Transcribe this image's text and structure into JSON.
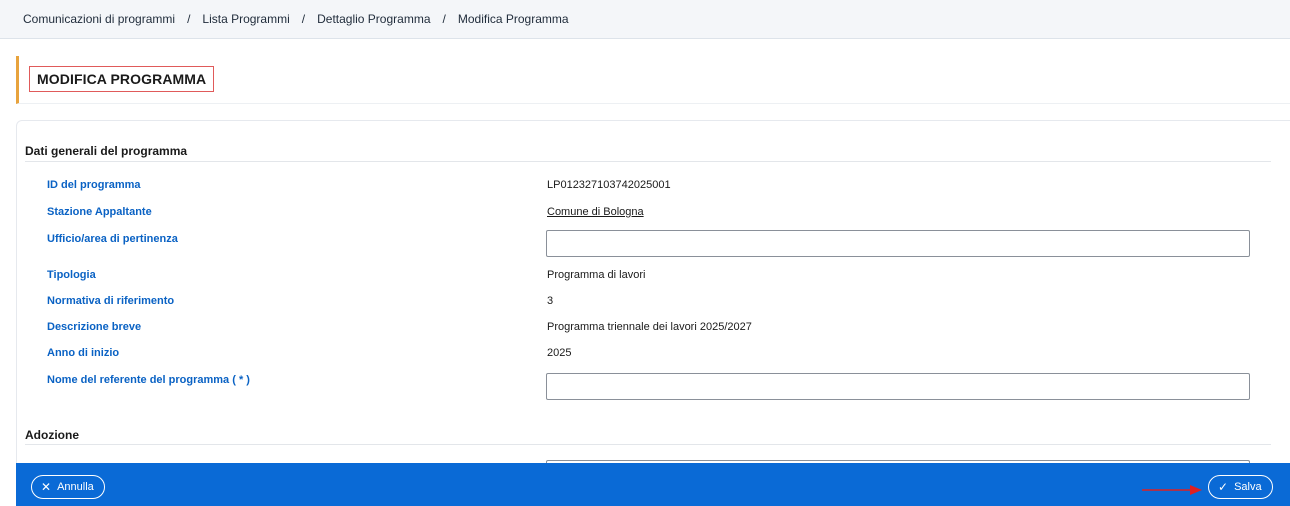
{
  "breadcrumb": {
    "items": [
      "Comunicazioni di programmi",
      "Lista Programmi",
      "Dettaglio Programma",
      "Modifica Programma"
    ],
    "separator": "/"
  },
  "page": {
    "title": "MODIFICA PROGRAMMA"
  },
  "general": {
    "section_title": "Dati generali del programma",
    "fields": [
      {
        "label": "ID del programma",
        "value": "LP012327103742025001"
      },
      {
        "label": "Stazione Appaltante",
        "value": "Comune di Bologna"
      },
      {
        "label": "Ufficio/area di pertinenza",
        "value": ""
      },
      {
        "label": "Tipologia",
        "value": "Programma di lavori"
      },
      {
        "label": "Normativa di riferimento",
        "value": "3"
      },
      {
        "label": "Descrizione breve",
        "value": "Programma triennale dei lavori 2025/2027"
      },
      {
        "label": "Anno di inizio",
        "value": "2025"
      },
      {
        "label": "Nome del referente del programma ( * )",
        "value": ""
      }
    ]
  },
  "adozione": {
    "section_title": "Adozione"
  },
  "footer": {
    "cancel_label": "Annulla",
    "save_label": "Salva"
  },
  "icons": {
    "cancel": "close-icon",
    "save": "check-icon"
  },
  "colors": {
    "accent": "#0a6ad6",
    "label": "#0a62c4",
    "title_marker": "#e8a33d",
    "annotation": "#e02020"
  }
}
